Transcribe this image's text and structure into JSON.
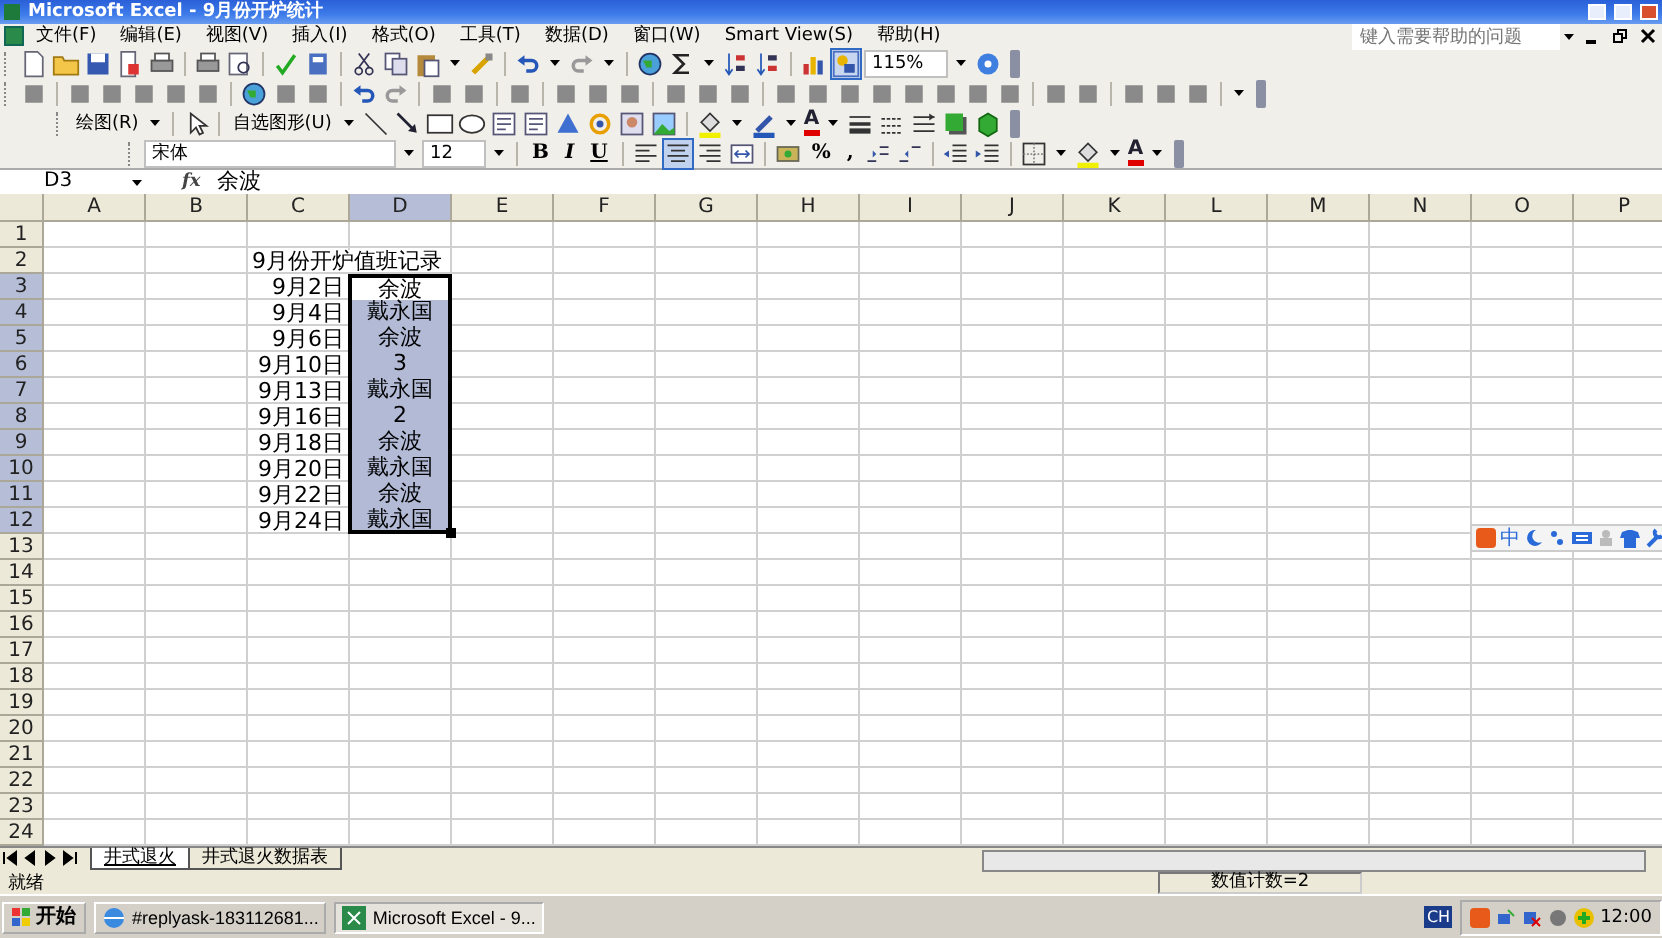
{
  "window": {
    "title": "Microsoft Excel - 9月份开炉统计"
  },
  "menu": [
    "文件(F)",
    "编辑(E)",
    "视图(V)",
    "插入(I)",
    "格式(O)",
    "工具(T)",
    "数据(D)",
    "窗口(W)",
    "Smart View(S)",
    "帮助(H)"
  ],
  "help_search": {
    "placeholder": "键入需要帮助的问题"
  },
  "standard_toolbar": {
    "zoom": "115%"
  },
  "drawing_toolbar": {
    "draw_menu": "绘图(R)",
    "autoshapes_menu": "自选图形(U)",
    "font_color": "A"
  },
  "formatting_toolbar": {
    "font": "宋体",
    "size": "12",
    "bold": "B",
    "italic": "I",
    "underline": "U",
    "percent": "%",
    "comma": ",",
    "font_color": "A"
  },
  "formula_bar": {
    "name_box": "D3",
    "fx": "fx",
    "content": "余波"
  },
  "columns": [
    {
      "label": "A",
      "selected": false
    },
    {
      "label": "B",
      "selected": false
    },
    {
      "label": "C",
      "selected": false
    },
    {
      "label": "D",
      "selected": true
    },
    {
      "label": "E",
      "selected": false
    },
    {
      "label": "F",
      "selected": false
    },
    {
      "label": "G",
      "selected": false
    },
    {
      "label": "H",
      "selected": false
    },
    {
      "label": "I",
      "selected": false
    },
    {
      "label": "J",
      "selected": false
    },
    {
      "label": "K",
      "selected": false
    },
    {
      "label": "L",
      "selected": false
    },
    {
      "label": "M",
      "selected": false
    },
    {
      "label": "N",
      "selected": false
    },
    {
      "label": "O",
      "selected": false
    },
    {
      "label": "P",
      "selected": false
    }
  ],
  "rows": [
    {
      "label": "1",
      "selected": false
    },
    {
      "label": "2",
      "selected": false,
      "cells": [
        {
          "selected": false
        },
        {
          "selected": false
        },
        {
          "value": "9月份开炉值班记录",
          "selected": false
        }
      ]
    },
    {
      "label": "3",
      "selected": true,
      "cells": [
        {
          "selected": false
        },
        {
          "selected": false
        },
        {
          "value": "9月2日",
          "selected": false
        },
        {
          "value": "余波",
          "selected": true
        }
      ]
    },
    {
      "label": "4",
      "selected": true,
      "cells": [
        {
          "selected": false
        },
        {
          "selected": false
        },
        {
          "value": "9月4日",
          "selected": false
        },
        {
          "value": "戴永国",
          "selected": true
        }
      ]
    },
    {
      "label": "5",
      "selected": true,
      "cells": [
        {
          "selected": false
        },
        {
          "selected": false
        },
        {
          "value": "9月6日",
          "selected": false
        },
        {
          "value": "余波",
          "selected": true
        }
      ]
    },
    {
      "label": "6",
      "selected": true,
      "cells": [
        {
          "selected": false
        },
        {
          "selected": false
        },
        {
          "value": "9月10日",
          "selected": false
        },
        {
          "value": "3",
          "selected": true
        }
      ]
    },
    {
      "label": "7",
      "selected": true,
      "cells": [
        {
          "selected": false
        },
        {
          "selected": false
        },
        {
          "value": "9月13日",
          "selected": false
        },
        {
          "value": "戴永国",
          "selected": true
        }
      ]
    },
    {
      "label": "8",
      "selected": true,
      "cells": [
        {
          "selected": false
        },
        {
          "selected": false
        },
        {
          "value": "9月16日",
          "selected": false
        },
        {
          "value": "2",
          "selected": true
        }
      ]
    },
    {
      "label": "9",
      "selected": true,
      "cells": [
        {
          "selected": false
        },
        {
          "selected": false
        },
        {
          "value": "9月18日",
          "selected": false
        },
        {
          "value": "余波",
          "selected": true
        }
      ]
    },
    {
      "label": "10",
      "selected": true,
      "cells": [
        {
          "selected": false
        },
        {
          "selected": false
        },
        {
          "value": "9月20日",
          "selected": false
        },
        {
          "value": "戴永国",
          "selected": true
        }
      ]
    },
    {
      "label": "11",
      "selected": true,
      "cells": [
        {
          "selected": false
        },
        {
          "selected": false
        },
        {
          "value": "9月22日",
          "selected": false
        },
        {
          "value": "余波",
          "selected": true
        }
      ]
    },
    {
      "label": "12",
      "selected": true,
      "cells": [
        {
          "selected": false
        },
        {
          "selected": false
        },
        {
          "value": "9月24日",
          "selected": false
        },
        {
          "value": "戴永国",
          "selected": true
        }
      ]
    },
    {
      "label": "13",
      "selected": false
    },
    {
      "label": "14",
      "selected": false
    },
    {
      "label": "15",
      "selected": false
    },
    {
      "label": "16",
      "selected": false
    },
    {
      "label": "17",
      "selected": false
    },
    {
      "label": "18",
      "selected": false
    },
    {
      "label": "19",
      "selected": false
    },
    {
      "label": "20",
      "selected": false
    },
    {
      "label": "21",
      "selected": false
    },
    {
      "label": "22",
      "selected": false
    },
    {
      "label": "23",
      "selected": false
    },
    {
      "label": "24",
      "selected": false
    }
  ],
  "ime_toolbar": {
    "mode": "中"
  },
  "sheet_tabs": [
    {
      "label": "井式退火",
      "selected": true
    },
    {
      "label": "井式退火数据表",
      "selected": false
    }
  ],
  "status_bar": {
    "status": "就绪",
    "summary": "数值计数=2"
  },
  "taskbar": {
    "start": "开始",
    "tasks": [
      {
        "label": "#replyask-183112681...",
        "selected": false
      },
      {
        "label": "Microsoft Excel - 9...",
        "selected": true
      }
    ],
    "language": "CH",
    "clock": "12:00"
  }
}
